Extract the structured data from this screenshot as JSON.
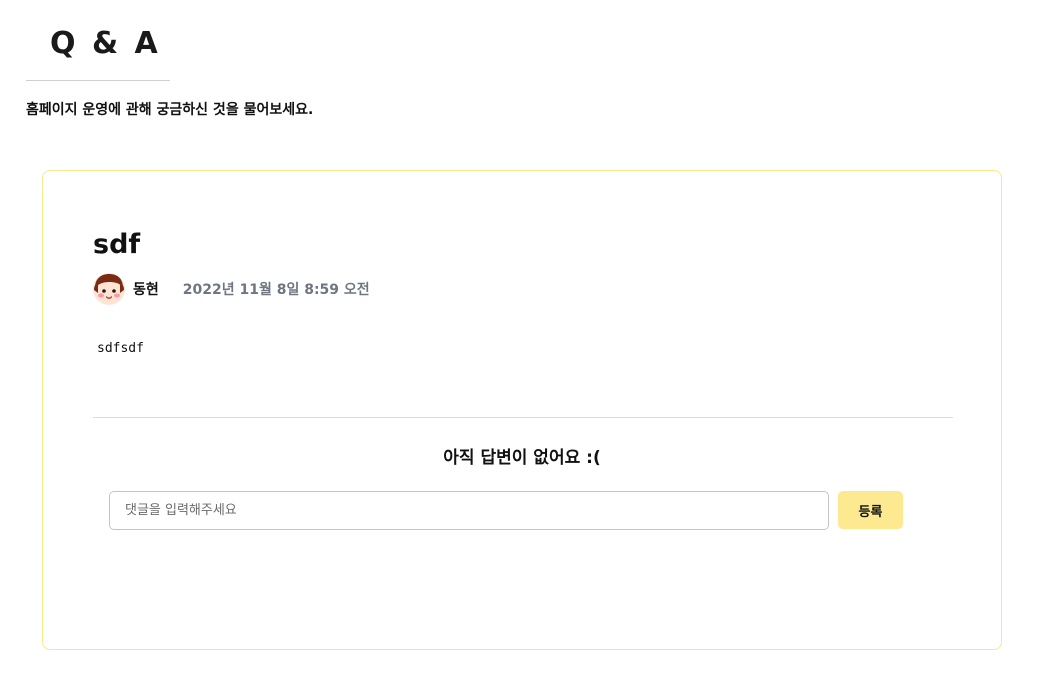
{
  "header": {
    "title": "Q & A",
    "subtitle": "홈페이지 운영에 관해 궁금하신 것을 물어보세요."
  },
  "post": {
    "title": "sdf",
    "author": "동현",
    "date": "2022년 11월 8일 8:59 오전",
    "body": "sdfsdf"
  },
  "answers": {
    "empty_message": "아직 답변이 없어요 :("
  },
  "comment": {
    "placeholder": "댓글을 입력해주세요",
    "submit_label": "등록"
  },
  "colors": {
    "card_border": "#f7e98c",
    "divider": "#f2e27a",
    "submit_button": "#fde98f",
    "date_text": "#6f7682"
  },
  "icons": {
    "avatar": "cartoon-face-avatar"
  }
}
